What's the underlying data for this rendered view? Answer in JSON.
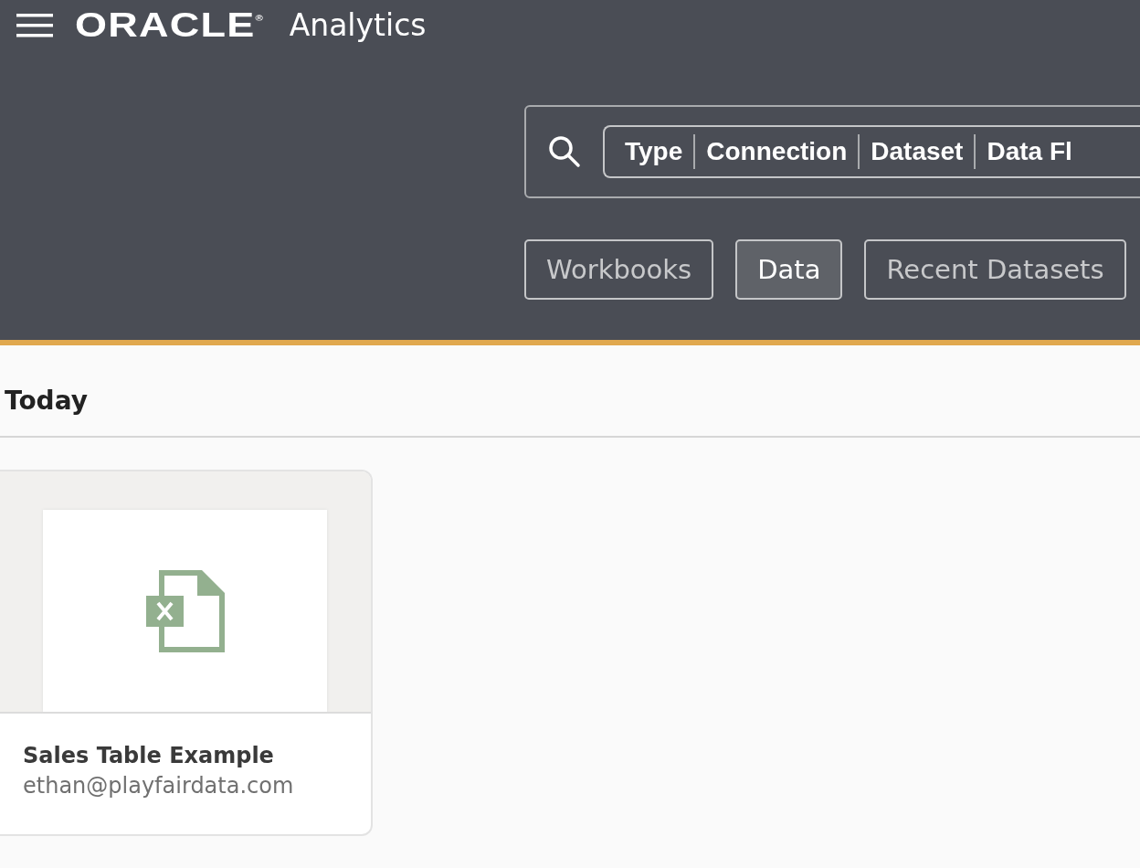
{
  "header": {
    "brand": "ORACLE",
    "registered": "®",
    "product": "Analytics"
  },
  "search": {
    "filters": [
      {
        "label": "Type"
      },
      {
        "label": "Connection"
      },
      {
        "label": "Dataset"
      },
      {
        "label": "Data Fl"
      }
    ]
  },
  "views": [
    {
      "label": "Workbooks",
      "selected": false
    },
    {
      "label": "Data",
      "selected": true
    },
    {
      "label": "Recent Datasets",
      "selected": false
    }
  ],
  "section": {
    "title": "Today"
  },
  "items": [
    {
      "kind": "excel",
      "title": "Sales Table Example",
      "owner": "ethan@playfairdata.com"
    }
  ]
}
